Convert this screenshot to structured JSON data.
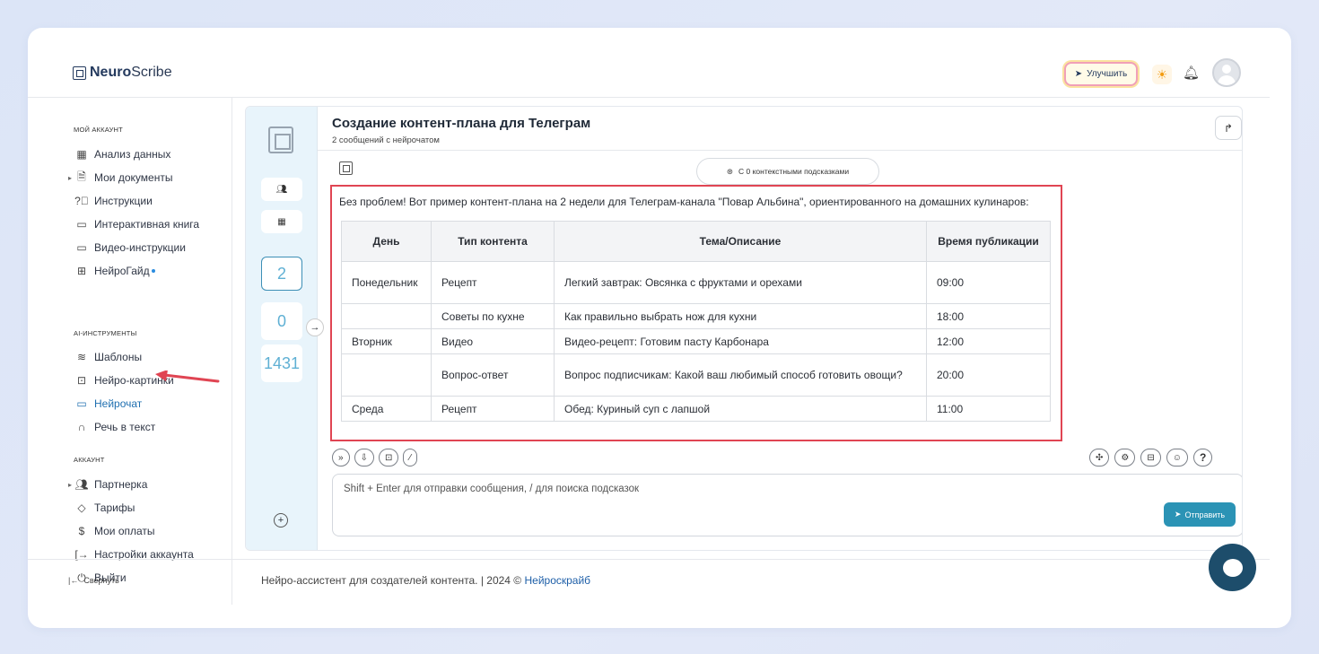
{
  "app": {
    "logo_bold": "Neuro",
    "logo_rest": "Scribe"
  },
  "header": {
    "upgrade_label": "Улучшить",
    "icons": [
      "rocket-icon",
      "sun-icon",
      "bell-icon",
      "avatar"
    ]
  },
  "sidebar": {
    "section_account": "МОЙ АККАУНТ",
    "account_items": [
      {
        "label": "Анализ данных",
        "icon": "grid-icon"
      },
      {
        "label": "Мои документы",
        "icon": "document-icon"
      },
      {
        "label": "Инструкции",
        "icon": "help-icon"
      },
      {
        "label": "Интерактивная книга",
        "icon": "book-icon"
      },
      {
        "label": "Видео-инструкции",
        "icon": "video-icon"
      },
      {
        "label": "НейроГайд",
        "icon": "table-icon"
      }
    ],
    "section_ai": "AI-ИНСТРУМЕНТЫ",
    "ai_items": [
      {
        "label": "Шаблоны",
        "icon": "layers-icon"
      },
      {
        "label": "Нейро-картинки",
        "icon": "image-icon"
      },
      {
        "label": "Нейрочат",
        "icon": "chat-icon"
      },
      {
        "label": "Речь в текст",
        "icon": "headphones-icon"
      }
    ],
    "section_acc2": "АККАУНТ",
    "acc2_items": [
      {
        "label": "Партнерка",
        "icon": "users-icon"
      },
      {
        "label": "Тарифы",
        "icon": "tag-icon"
      },
      {
        "label": "Мои оплаты",
        "icon": "dollar-icon"
      },
      {
        "label": "Настройки аккаунта",
        "icon": "settings-icon"
      },
      {
        "label": "Выйти",
        "icon": "power-icon"
      }
    ],
    "collapse_label": "Свернуть"
  },
  "rail": {
    "counter_selected": "2",
    "counter_2": "0",
    "counter_3": "1431"
  },
  "chat": {
    "title": "Создание контент-плана для Телеграм",
    "subtitle": "2 сообщений с нейрочатом",
    "context_pill": "С 0 контекстными подсказками",
    "intro": "Без проблем! Вот пример контент-плана на 2 недели для Телеграм-канала \"Повар Альбина\", ориентированного на домашних кулинаров:",
    "table": {
      "headers": [
        "День",
        "Тип контента",
        "Тема/Описание",
        "Время публикации"
      ],
      "rows": [
        [
          "Понедельник",
          "Рецепт",
          "Легкий завтрак: Овсянка с фруктами и орехами",
          "09:00"
        ],
        [
          "",
          "Советы по кухне",
          "Как правильно выбрать нож для кухни",
          "18:00"
        ],
        [
          "Вторник",
          "Видео",
          "Видео-рецепт: Готовим пасту Карбонара",
          "12:00"
        ],
        [
          "",
          "Вопрос-ответ",
          "Вопрос подписчикам: Какой ваш любимый способ готовить овощи?",
          "20:00"
        ],
        [
          "Среда",
          "Рецепт",
          "Обед: Куриный суп с лапшой",
          "11:00"
        ]
      ]
    },
    "input_placeholder": "Shift + Enter для отправки сообщения, / для поиска подсказок",
    "send_label": "Отправить"
  },
  "footer": {
    "text": "Нейро-ассистент для создателей контента.  | 2024 © ",
    "link": "Нейроскрайб"
  }
}
